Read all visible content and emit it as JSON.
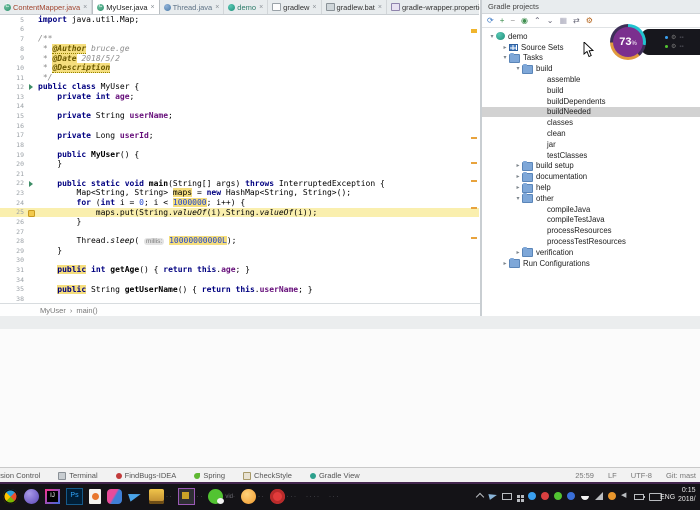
{
  "tabs": {
    "items": [
      {
        "label": "ContentMapper.java",
        "close": "×",
        "icon": "class",
        "color": "#a2452f",
        "active": false
      },
      {
        "label": "MyUser.java",
        "close": "×",
        "icon": "class",
        "color": "#222222",
        "active": true
      },
      {
        "label": "Thread.java",
        "close": "×",
        "icon": "class-lock",
        "color": "#5f7386",
        "active": false
      },
      {
        "label": "demo",
        "close": "×",
        "icon": "gradle",
        "color": "#2e7d6b",
        "active": false
      },
      {
        "label": "gradlew",
        "close": "×",
        "icon": "file",
        "color": "#333333",
        "active": false
      },
      {
        "label": "gradlew.bat",
        "close": "×",
        "icon": "bat",
        "color": "#333333",
        "active": false
      },
      {
        "label": "gradle-wrapper.properties",
        "close": "×",
        "icon": "properties",
        "color": "#333333",
        "active": false
      }
    ]
  },
  "editor": {
    "lines": [
      {
        "n": 5,
        "s": [
          [
            "k",
            "import"
          ],
          [
            "p",
            " java.util.Map;"
          ]
        ]
      },
      {
        "n": 6,
        "s": []
      },
      {
        "n": 7,
        "s": [
          [
            "c",
            "/**"
          ]
        ]
      },
      {
        "n": 8,
        "s": [
          [
            "c",
            " * "
          ],
          [
            "t",
            "@Author"
          ],
          [
            "c",
            " bruce.ge"
          ]
        ]
      },
      {
        "n": 9,
        "s": [
          [
            "c",
            " * "
          ],
          [
            "t",
            "@Date"
          ],
          [
            "c",
            " 2018/5/2"
          ]
        ]
      },
      {
        "n": 10,
        "s": [
          [
            "c",
            " * "
          ],
          [
            "t",
            "@Description"
          ]
        ]
      },
      {
        "n": 11,
        "s": [
          [
            "c",
            " */"
          ]
        ]
      },
      {
        "n": 12,
        "g": "run",
        "s": [
          [
            "k",
            "public class"
          ],
          [
            "p",
            " MyUser {"
          ]
        ]
      },
      {
        "n": 13,
        "s": [
          [
            "p",
            "    "
          ],
          [
            "k",
            "private int"
          ],
          [
            "p",
            " "
          ],
          [
            "f",
            "age"
          ],
          [
            "p",
            ";"
          ]
        ]
      },
      {
        "n": 14,
        "s": []
      },
      {
        "n": 15,
        "s": [
          [
            "p",
            "    "
          ],
          [
            "k",
            "private"
          ],
          [
            "p",
            " String "
          ],
          [
            "f",
            "userName"
          ],
          [
            "p",
            ";"
          ]
        ]
      },
      {
        "n": 16,
        "s": []
      },
      {
        "n": 17,
        "s": [
          [
            "p",
            "    "
          ],
          [
            "k",
            "private"
          ],
          [
            "p",
            " Long "
          ],
          [
            "f",
            "userId"
          ],
          [
            "p",
            ";"
          ]
        ]
      },
      {
        "n": 18,
        "s": []
      },
      {
        "n": 19,
        "s": [
          [
            "p",
            "    "
          ],
          [
            "k",
            "public"
          ],
          [
            "p",
            " "
          ],
          [
            "m",
            "MyUser"
          ],
          [
            "p",
            "() {"
          ]
        ]
      },
      {
        "n": 20,
        "s": [
          [
            "p",
            "    }"
          ]
        ]
      },
      {
        "n": 21,
        "s": []
      },
      {
        "n": 22,
        "g": "run",
        "s": [
          [
            "p",
            "    "
          ],
          [
            "k",
            "public static void"
          ],
          [
            "p",
            " "
          ],
          [
            "m",
            "main"
          ],
          [
            "p",
            "(String[] args) "
          ],
          [
            "k",
            "throws"
          ],
          [
            "p",
            " InterruptedException {"
          ]
        ]
      },
      {
        "n": 23,
        "s": [
          [
            "p",
            "        Map<String, String> "
          ],
          [
            "p",
            "maps",
            1
          ],
          [
            "p",
            " = "
          ],
          [
            "k",
            "new"
          ],
          [
            "p",
            " HashMap<String, String>();"
          ]
        ]
      },
      {
        "n": 24,
        "s": [
          [
            "p",
            "        "
          ],
          [
            "k",
            "for"
          ],
          [
            "p",
            " ("
          ],
          [
            "k",
            "int"
          ],
          [
            "p",
            " i = "
          ],
          [
            "n",
            "0"
          ],
          [
            "p",
            "; i < "
          ],
          [
            "n",
            "1000000",
            1
          ],
          [
            "p",
            "; i++) {"
          ]
        ]
      },
      {
        "n": 25,
        "g": "bulb",
        "bg": 1,
        "s": [
          [
            "p",
            "            maps.put(String."
          ],
          [
            "i",
            "valueOf"
          ],
          [
            "p",
            "(i),String."
          ],
          [
            "i",
            "valueOf"
          ],
          [
            "p",
            "(i));"
          ]
        ]
      },
      {
        "n": 26,
        "s": [
          [
            "p",
            "        }"
          ]
        ]
      },
      {
        "n": 27,
        "s": []
      },
      {
        "n": 28,
        "s": [
          [
            "p",
            "        Thread."
          ],
          [
            "i",
            "sleep"
          ],
          [
            "p",
            "( "
          ],
          [
            "hint",
            "millis:"
          ],
          [
            "p",
            " "
          ],
          [
            "n",
            "10000000000L",
            1
          ],
          [
            "p",
            ");"
          ]
        ]
      },
      {
        "n": 29,
        "s": [
          [
            "p",
            "    }"
          ]
        ]
      },
      {
        "n": 30,
        "s": []
      },
      {
        "n": 31,
        "s": [
          [
            "p",
            "    "
          ],
          [
            "k",
            "public",
            1
          ],
          [
            "p",
            " "
          ],
          [
            "k",
            "int"
          ],
          [
            "p",
            " "
          ],
          [
            "m",
            "getAge"
          ],
          [
            "p",
            "() { "
          ],
          [
            "k",
            "return this"
          ],
          [
            "p",
            "."
          ],
          [
            "f",
            "age"
          ],
          [
            "p",
            "; }"
          ]
        ]
      },
      {
        "n": 34,
        "s": []
      },
      {
        "n": 35,
        "s": [
          [
            "p",
            "    "
          ],
          [
            "k",
            "public",
            1
          ],
          [
            "p",
            " String "
          ],
          [
            "m",
            "getUserName"
          ],
          [
            "p",
            "() { "
          ],
          [
            "k",
            "return this"
          ],
          [
            "p",
            "."
          ],
          [
            "f",
            "userName"
          ],
          [
            "p",
            "; }"
          ]
        ]
      },
      {
        "n": 38,
        "s": []
      }
    ]
  },
  "breadcrumb": {
    "items": [
      "MyUser",
      "main()"
    ],
    "sep": "›"
  },
  "gradle_panel": {
    "title": "Gradle projects",
    "toolbar": [
      "refresh",
      "add",
      "remove",
      "execute",
      "collapse-all",
      "expand-all",
      "group-tasks",
      "toggle",
      "settings"
    ],
    "tree": [
      {
        "d": 0,
        "chev": "v",
        "icon": "gradle",
        "label": "demo"
      },
      {
        "d": 1,
        "chev": ">",
        "icon": "sourcesets",
        "label": "Source Sets"
      },
      {
        "d": 1,
        "chev": "v",
        "icon": "folder",
        "label": "Tasks"
      },
      {
        "d": 2,
        "chev": "v",
        "icon": "folder",
        "label": "build"
      },
      {
        "d": 3,
        "chev": "",
        "icon": "task",
        "label": "assemble"
      },
      {
        "d": 3,
        "chev": "",
        "icon": "task",
        "label": "build"
      },
      {
        "d": 3,
        "chev": "",
        "icon": "task",
        "label": "buildDependents"
      },
      {
        "d": 3,
        "chev": "",
        "icon": "task",
        "label": "buildNeeded",
        "sel": 1
      },
      {
        "d": 3,
        "chev": "",
        "icon": "task",
        "label": "classes"
      },
      {
        "d": 3,
        "chev": "",
        "icon": "task",
        "label": "clean"
      },
      {
        "d": 3,
        "chev": "",
        "icon": "task",
        "label": "jar"
      },
      {
        "d": 3,
        "chev": "",
        "icon": "task",
        "label": "testClasses"
      },
      {
        "d": 2,
        "chev": ">",
        "icon": "folder",
        "label": "build setup"
      },
      {
        "d": 2,
        "chev": ">",
        "icon": "folder",
        "label": "documentation"
      },
      {
        "d": 2,
        "chev": ">",
        "icon": "folder",
        "label": "help"
      },
      {
        "d": 2,
        "chev": "v",
        "icon": "folder",
        "label": "other"
      },
      {
        "d": 3,
        "chev": "",
        "icon": "task",
        "label": "compileJava"
      },
      {
        "d": 3,
        "chev": "",
        "icon": "task",
        "label": "compileTestJava"
      },
      {
        "d": 3,
        "chev": "",
        "icon": "task",
        "label": "processResources"
      },
      {
        "d": 3,
        "chev": "",
        "icon": "task",
        "label": "processTestResources"
      },
      {
        "d": 2,
        "chev": ">",
        "icon": "folder",
        "label": "verification"
      },
      {
        "d": 1,
        "chev": ">",
        "icon": "folder",
        "label": "Run Configurations"
      }
    ]
  },
  "overlay": {
    "percent": "73",
    "unit": "%",
    "rows": [
      {
        "dot": "#3aa0f0"
      },
      {
        "dot": "#52c332"
      }
    ]
  },
  "statusbar": {
    "tools": [
      {
        "label": "Version Control",
        "icon": ""
      },
      {
        "label": "Terminal",
        "icon": "terminal"
      },
      {
        "label": "FindBugs-IDEA",
        "icon": "bug"
      },
      {
        "label": "Spring",
        "icon": "leaf"
      },
      {
        "label": "CheckStyle",
        "icon": "checkstyle"
      },
      {
        "label": "Gradle View",
        "icon": "gradle-plus"
      }
    ],
    "position": "25:59",
    "line_ending": "LF",
    "encoding": "UTF-8",
    "vcs": "Git: mast"
  },
  "taskbar": {
    "apps": [
      {
        "name": "start",
        "kind": "start"
      },
      {
        "name": "browser",
        "kind": "circle"
      },
      {
        "name": "intellij-idea",
        "kind": "idea"
      },
      {
        "name": "photoshop",
        "kind": "ps",
        "glyph": "Ps"
      },
      {
        "name": "document-viewer",
        "kind": "doc"
      },
      {
        "name": "chat-app",
        "kind": "chat"
      },
      {
        "name": "paper-plane-app",
        "kind": "plane"
      },
      {
        "name": "media-player",
        "kind": "music",
        "label": "· ·"
      },
      {
        "name": "active-window",
        "kind": "activewin",
        "label": "· ·"
      },
      {
        "name": "wechat",
        "kind": "wechat",
        "label": "vid·"
      },
      {
        "name": "sun-app",
        "kind": "sun",
        "label": "· ·"
      },
      {
        "name": "red-app",
        "kind": "redapp",
        "label": "· · ·"
      },
      {
        "name": "more-window",
        "kind": "dim",
        "label": "· · · ·"
      },
      {
        "name": "more-window",
        "kind": "dim",
        "label": "· · ·"
      }
    ],
    "tray": [
      {
        "name": "tray-expand",
        "kind": "chevron"
      },
      {
        "name": "tray-plane",
        "kind": "plane"
      },
      {
        "name": "tray-display",
        "kind": "display"
      },
      {
        "name": "tray-windows",
        "kind": "win"
      },
      {
        "name": "tray-app-blue",
        "kind": "dot",
        "color": "#3aa0f0"
      },
      {
        "name": "tray-app-red",
        "kind": "dot",
        "color": "#d94040"
      },
      {
        "name": "tray-app-green",
        "kind": "dot",
        "color": "#52c332"
      },
      {
        "name": "tray-app-blue2",
        "kind": "dot",
        "color": "#3a6fd9"
      },
      {
        "name": "tray-qq",
        "kind": "penguin"
      },
      {
        "name": "tray-signal",
        "kind": "signal"
      },
      {
        "name": "tray-app-orange",
        "kind": "dot",
        "color": "#e8962d"
      },
      {
        "name": "tray-volume",
        "kind": "speaker",
        "glyph": "◀"
      },
      {
        "name": "tray-battery",
        "kind": "battery"
      },
      {
        "name": "tray-keyboard",
        "kind": "keyboard"
      }
    ],
    "language": "ENG",
    "clock": {
      "time": "0:15",
      "date": "2018/"
    }
  },
  "colors": {
    "selection": "#d2d2d2",
    "caret_line": "#faefae",
    "usage_highlight": "#f5de7e",
    "badge_purple": "#7b2f8e",
    "ring_teal": "#22c3cf",
    "ring_orange": "#e09a3e",
    "taskbar_bg": "#141317"
  }
}
